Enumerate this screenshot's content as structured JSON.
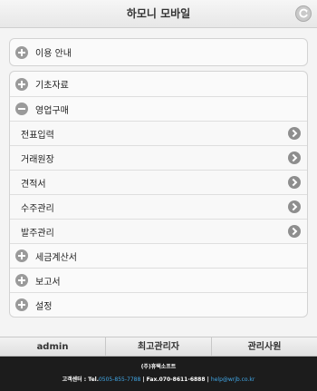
{
  "header": {
    "title": "하모니 모바일"
  },
  "menu": {
    "guide": "이용 안내",
    "basic": "기초자료",
    "sales": "영업구매",
    "sub_items": [
      {
        "label": "전표입력"
      },
      {
        "label": "거래원장"
      },
      {
        "label": "견적서"
      },
      {
        "label": "수주관리"
      },
      {
        "label": "발주관리"
      }
    ],
    "tax": "세금계산서",
    "report": "보고서",
    "settings": "설정"
  },
  "tabs": {
    "user": "admin",
    "admin": "최고관리자",
    "staff": "관리사원"
  },
  "footer": {
    "company": "(주)휴택소프트",
    "center": "고객센터 : Tel.",
    "tel": "0505-855-7788",
    "fax": " | Fax.070-8611-6888 | ",
    "email": "help@wrjb.co.kr"
  },
  "colors": {
    "link": "#41a8e8",
    "footer_bg": "#1c1c1c"
  }
}
